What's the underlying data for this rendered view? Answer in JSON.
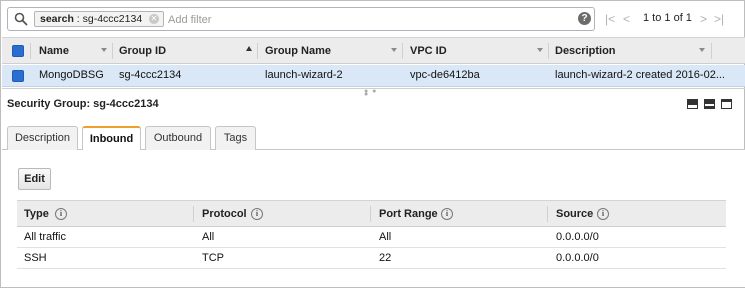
{
  "search": {
    "token_key": "search",
    "token_value": "sg-4ccc2134",
    "placeholder": "Add filter"
  },
  "pagination": {
    "text": "1 to 1 of 1"
  },
  "grid": {
    "columns": [
      "Name",
      "Group ID",
      "Group Name",
      "VPC ID",
      "Description"
    ],
    "rows": [
      {
        "name": "MongoDBSG",
        "group_id": "sg-4ccc2134",
        "group_name": "launch-wizard-2",
        "vpc_id": "vpc-de6412ba",
        "description": "launch-wizard-2 created 2016-02..."
      }
    ]
  },
  "detail": {
    "title": "Security Group: sg-4ccc2134"
  },
  "tabs": [
    "Description",
    "Inbound",
    "Outbound",
    "Tags"
  ],
  "active_tab": "Inbound",
  "inbound": {
    "edit_label": "Edit",
    "columns": [
      "Type",
      "Protocol",
      "Port Range",
      "Source"
    ],
    "rows": [
      {
        "type": "All traffic",
        "protocol": "All",
        "port_range": "All",
        "source": "0.0.0.0/0"
      },
      {
        "type": "SSH",
        "protocol": "TCP",
        "port_range": "22",
        "source": "0.0.0.0/0"
      }
    ]
  },
  "colors": {
    "selected_row": "#d9e7f6",
    "header_bg": "#ececec",
    "active_tab_accent": "#f0a02a",
    "checkbox": "#2a6fd0"
  },
  "icons": {
    "search": "magnifier-icon",
    "help": "help-icon",
    "pager": [
      "first-page-icon",
      "prev-page-icon",
      "next-page-icon",
      "last-page-icon"
    ],
    "info": "info-icon",
    "layout": [
      "layout-bottom-icon",
      "layout-split-icon",
      "layout-top-icon"
    ]
  }
}
